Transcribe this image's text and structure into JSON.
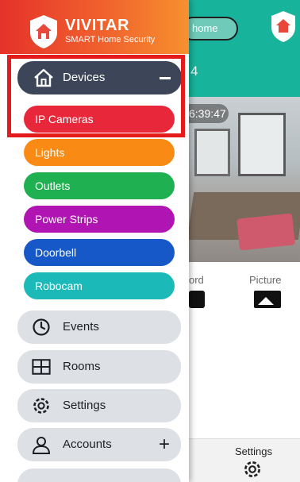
{
  "background": {
    "home_pill": "home",
    "header_digit": "4",
    "video_time": "6:39:47",
    "record_label": "ord",
    "picture_label": "Picture",
    "footer_settings_label": "Settings"
  },
  "drawer": {
    "brand_name": "VIVITAR",
    "brand_sub": "SMART Home Security",
    "devices_label": "Devices",
    "sub_items": [
      {
        "label": "IP Cameras",
        "color": "#e8283a"
      },
      {
        "label": "Lights",
        "color": "#f98a14"
      },
      {
        "label": "Outlets",
        "color": "#1fb052"
      },
      {
        "label": "Power Strips",
        "color": "#b014b3"
      },
      {
        "label": "Doorbell",
        "color": "#1758c9"
      },
      {
        "label": "Robocam",
        "color": "#1bbab8"
      }
    ],
    "menu": {
      "events": "Events",
      "rooms": "Rooms",
      "settings": "Settings",
      "accounts": "Accounts"
    }
  },
  "colors": {
    "accent": "#e41b1b",
    "header_teal": "#17b39a",
    "devices_bg": "#3d4658",
    "menu_bg": "#dde0e5"
  }
}
